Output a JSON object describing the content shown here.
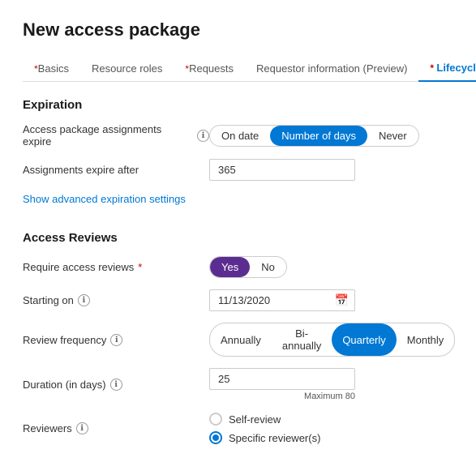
{
  "page": {
    "title": "New access package"
  },
  "tabs": [
    {
      "id": "basics",
      "label": "Basics",
      "required": true,
      "active": false
    },
    {
      "id": "resource-roles",
      "label": "Resource roles",
      "required": false,
      "active": false
    },
    {
      "id": "requests",
      "label": "Requests",
      "required": true,
      "active": false
    },
    {
      "id": "requestor-info",
      "label": "Requestor information (Preview)",
      "required": false,
      "active": false
    },
    {
      "id": "lifecycle",
      "label": "Lifecycle",
      "required": true,
      "active": true
    }
  ],
  "expiration": {
    "section_title": "Expiration",
    "assignments_expire_label": "Access package assignments expire",
    "expire_options": [
      "On date",
      "Number of days",
      "Never"
    ],
    "expire_selected": "Number of days",
    "assignments_expire_after_label": "Assignments expire after",
    "expire_days_value": "365",
    "show_advanced_link": "Show advanced expiration settings"
  },
  "access_reviews": {
    "section_title": "Access Reviews",
    "require_label": "Require access reviews",
    "require_options": [
      "Yes",
      "No"
    ],
    "require_selected": "Yes",
    "require_selected_style": "purple",
    "starting_on_label": "Starting on",
    "starting_on_value": "11/13/2020",
    "review_frequency_label": "Review frequency",
    "frequency_options": [
      "Annually",
      "Bi-annually",
      "Quarterly",
      "Monthly"
    ],
    "frequency_selected": "Quarterly",
    "duration_label": "Duration (in days)",
    "duration_value": "25",
    "duration_max_hint": "Maximum 80",
    "reviewers_label": "Reviewers",
    "reviewer_options": [
      {
        "id": "self-review",
        "label": "Self-review",
        "selected": false
      },
      {
        "id": "specific-reviewer",
        "label": "Specific reviewer(s)",
        "selected": true
      }
    ]
  },
  "icons": {
    "info": "ℹ",
    "calendar": "📅"
  }
}
